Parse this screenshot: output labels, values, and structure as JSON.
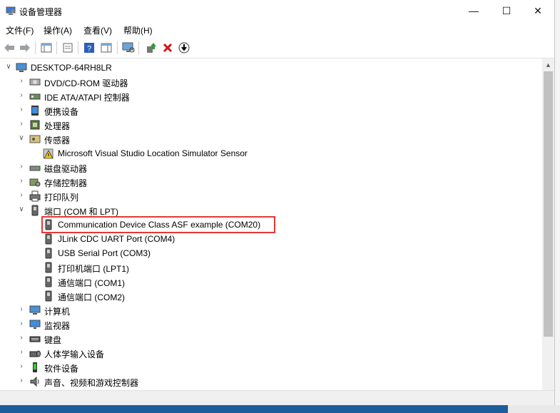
{
  "window": {
    "title": "设备管理器"
  },
  "menu": [
    "文件(F)",
    "操作(A)",
    "查看(V)",
    "帮助(H)"
  ],
  "tree": {
    "root": "DESKTOP-64RH8LR",
    "items": [
      {
        "label": "DVD/CD-ROM 驱动器",
        "icon": "dvd-icon",
        "expanded": false
      },
      {
        "label": "IDE ATA/ATAPI 控制器",
        "icon": "ide-controller-icon",
        "expanded": false
      },
      {
        "label": "便携设备",
        "icon": "portable-device-icon",
        "expanded": false
      },
      {
        "label": "处理器",
        "icon": "processor-icon",
        "expanded": false
      },
      {
        "label": "传感器",
        "icon": "sensor-icon",
        "expanded": true,
        "children": [
          "Microsoft Visual Studio Location Simulator Sensor"
        ]
      },
      {
        "label": "磁盘驱动器",
        "icon": "disk-drive-icon",
        "expanded": false
      },
      {
        "label": "存储控制器",
        "icon": "storage-controller-icon",
        "expanded": false
      },
      {
        "label": "打印队列",
        "icon": "printer-icon",
        "expanded": false
      },
      {
        "label": "端口 (COM 和 LPT)",
        "icon": "port-icon",
        "expanded": true,
        "children": [
          "Communication Device Class ASF example (COM20)",
          "JLink CDC UART Port (COM4)",
          "USB Serial Port (COM3)",
          "打印机端口 (LPT1)",
          "通信端口 (COM1)",
          "通信端口 (COM2)"
        ]
      },
      {
        "label": "计算机",
        "icon": "computer-icon",
        "expanded": false
      },
      {
        "label": "监视器",
        "icon": "monitor-icon",
        "expanded": false
      },
      {
        "label": "键盘",
        "icon": "keyboard-icon",
        "expanded": false
      },
      {
        "label": "人体学输入设备",
        "icon": "hid-icon",
        "expanded": false
      },
      {
        "label": "软件设备",
        "icon": "software-device-icon",
        "expanded": false
      },
      {
        "label": "声音、视频和游戏控制器",
        "icon": "sound-icon",
        "expanded": false
      }
    ]
  },
  "highlighted_item": "Communication Device Class ASF example (COM20)",
  "colors": {
    "highlight_border": "#e53935",
    "taskbar": "#1e5d9b"
  }
}
